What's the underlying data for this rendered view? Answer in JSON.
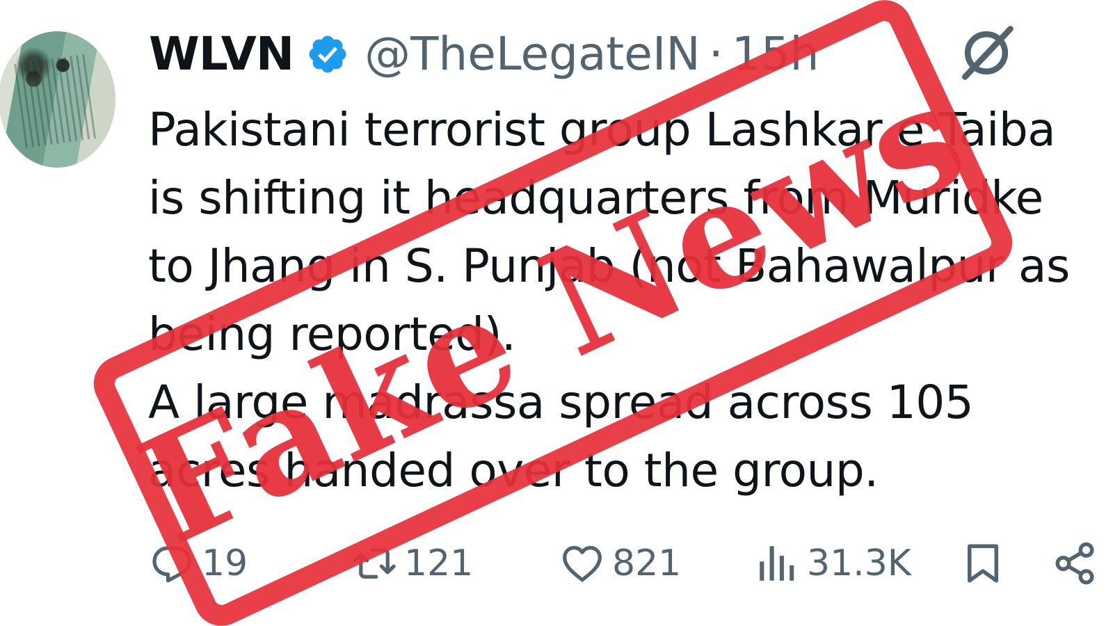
{
  "tweet": {
    "display_name": "WLVN",
    "handle": "@TheLegateIN",
    "separator": "·",
    "time": "15h",
    "text_lines": [
      "Pakistani terrorist group Lashkar e Taiba",
      "is shifting it headquarters from Muridke",
      "to Jhang in S. Punjab (not Bahawalpur as",
      "being reported).",
      "A large madrassa spread across 105",
      "acres handed over to the group."
    ],
    "icons": {
      "verified": "verified-badge-icon",
      "grok": "grok-icon"
    },
    "verified_color": "#1d9bf0"
  },
  "actions": {
    "replies": "19",
    "retweets": "121",
    "likes": "821",
    "views": "31.3K",
    "icons": [
      "reply-icon",
      "retweet-icon",
      "like-icon",
      "views-icon",
      "bookmark-icon",
      "share-icon"
    ]
  },
  "stamp": {
    "text": "Fake News",
    "color": "#e6303a"
  }
}
